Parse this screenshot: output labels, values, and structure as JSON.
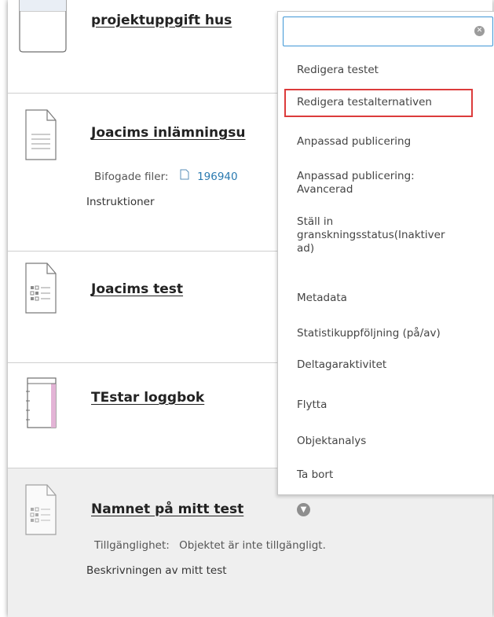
{
  "items": [
    {
      "title": "projektuppgift hus"
    },
    {
      "title": "Joacims inlämningsu",
      "attachments_label": "Bifogade filer:",
      "attachment_link": "196940",
      "instructions": "Instruktioner"
    },
    {
      "title": "Joacims test"
    },
    {
      "title": "TEstar loggbok"
    },
    {
      "title": "Namnet på mitt test",
      "availability_label": "Tillgänglighet:",
      "availability_value": "Objektet är inte tillgängligt.",
      "description": "Beskrivningen av mitt test"
    }
  ],
  "menu": {
    "search_value": "",
    "items": [
      {
        "label": "Redigera testet"
      },
      {
        "label": "Redigera testalternativen"
      },
      {
        "label": "Anpassad publicering"
      },
      {
        "label": "Anpassad publicering:",
        "label2": "Avancerad"
      },
      {
        "label": "Ställ in",
        "label2": "granskningsstatus(Inaktiver",
        "label3": "ad)"
      },
      {
        "label": "Metadata"
      },
      {
        "label": "Statistikuppföljning (på/av)"
      },
      {
        "label": "Deltagaraktivitet"
      },
      {
        "label": "Flytta"
      },
      {
        "label": "Objektanalys"
      },
      {
        "label": "Ta bort"
      }
    ]
  },
  "colors": {
    "link": "#2a7ab0",
    "highlight": "#dc3b3b",
    "focus": "#3f96d6"
  },
  "icons": [
    "folder-icon",
    "document-icon",
    "test-icon",
    "notebook-icon",
    "test-icon",
    "clear-icon",
    "chevron-down-icon",
    "attachment-icon"
  ]
}
